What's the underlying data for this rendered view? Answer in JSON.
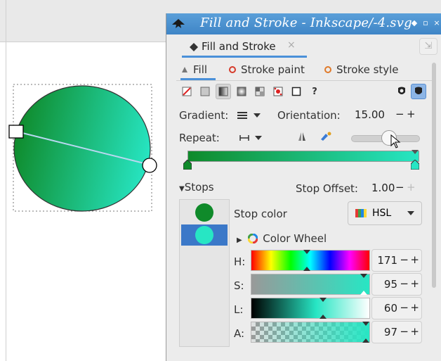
{
  "dialog": {
    "title": "Fill and Stroke - Inkscape/-4.svg",
    "tab_label": "Fill and Stroke",
    "tab_close": "×"
  },
  "subtabs": [
    {
      "label": "Fill"
    },
    {
      "label": "Stroke paint"
    },
    {
      "label": "Stroke style"
    }
  ],
  "paint_help": "?",
  "gradient": {
    "label": "Gradient:",
    "orientation_label": "Orientation:",
    "orientation_value": "15.00",
    "repeat_label": "Repeat:",
    "stops_label": "Stops",
    "stop_offset_label": "Stop Offset:",
    "stop_offset_value": "1.00",
    "start_color": "#0f8a2a",
    "end_color": "#27e6c4"
  },
  "stop_color": {
    "label": "Stop color",
    "mode": "HSL",
    "wheel_label": "Color Wheel"
  },
  "channels": [
    {
      "label": "H:",
      "value": "171"
    },
    {
      "label": "S:",
      "value": "95"
    },
    {
      "label": "L:",
      "value": "60"
    },
    {
      "label": "A:",
      "value": "97"
    }
  ],
  "icons": {
    "app": "inkscape-icon",
    "spinner_minus": "−",
    "spinner_plus": "+"
  }
}
